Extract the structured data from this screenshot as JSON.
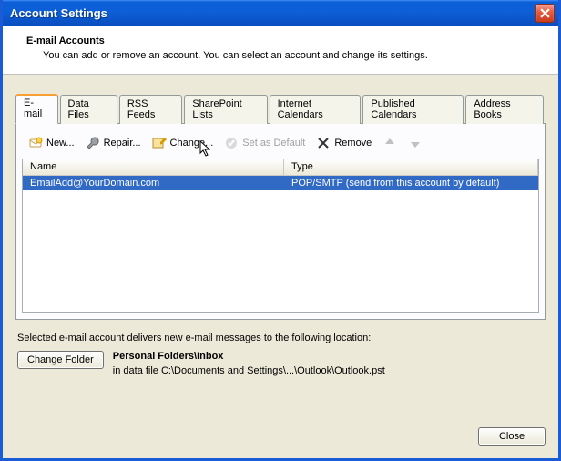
{
  "window": {
    "title": "Account Settings"
  },
  "header": {
    "title": "E-mail Accounts",
    "subtitle": "You can add or remove an account. You can select an account and change its settings."
  },
  "tabs": {
    "items": [
      {
        "label": "E-mail",
        "active": true
      },
      {
        "label": "Data Files"
      },
      {
        "label": "RSS Feeds"
      },
      {
        "label": "SharePoint Lists"
      },
      {
        "label": "Internet Calendars"
      },
      {
        "label": "Published Calendars"
      },
      {
        "label": "Address Books"
      }
    ]
  },
  "toolbar": {
    "new": "New...",
    "repair": "Repair...",
    "change": "Change...",
    "set_default": "Set as Default",
    "remove": "Remove"
  },
  "list": {
    "columns": {
      "name": "Name",
      "type": "Type"
    },
    "rows": [
      {
        "name": "EmailAdd@YourDomain.com",
        "type": "POP/SMTP (send from this account by default)",
        "selected": true
      }
    ]
  },
  "delivery": {
    "intro": "Selected e-mail account delivers new e-mail messages to the following location:",
    "change_folder": "Change Folder",
    "folder": "Personal Folders\\Inbox",
    "datafile": "in data file C:\\Documents and Settings\\...\\Outlook\\Outlook.pst"
  },
  "footer": {
    "close": "Close"
  }
}
